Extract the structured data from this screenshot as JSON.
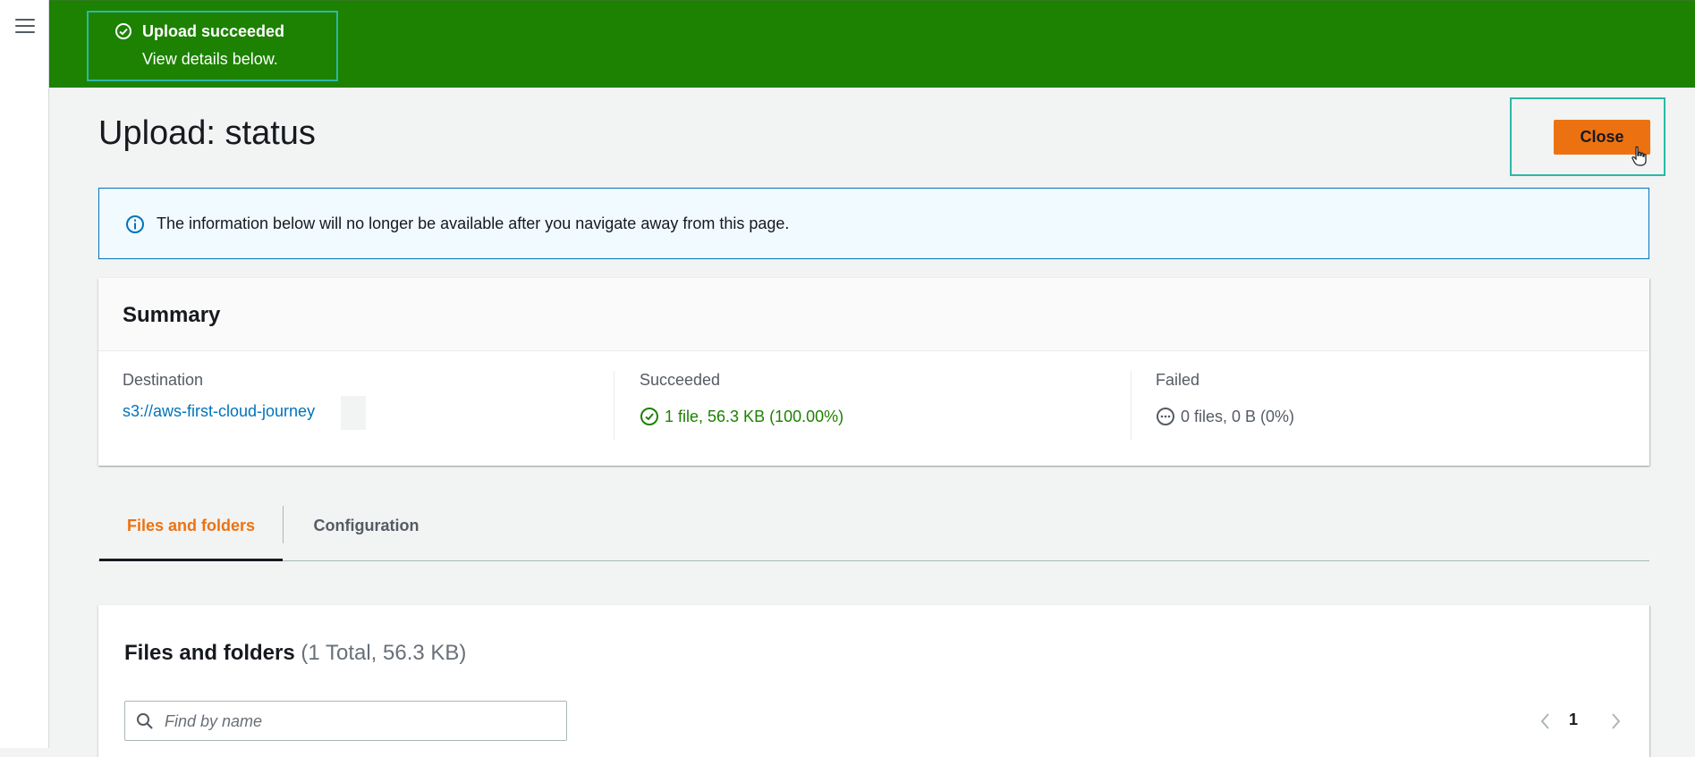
{
  "flash": {
    "title": "Upload succeeded",
    "subtitle": "View details below.",
    "icon": "check-circle-icon",
    "color": "#1d8102"
  },
  "page": {
    "title": "Upload: status",
    "close_label": "Close"
  },
  "info": {
    "icon": "info-icon",
    "text": "The information below will no longer be available after you navigate away from this page."
  },
  "summary": {
    "title": "Summary",
    "destination_label": "Destination",
    "destination_value": "s3://aws-first-cloud-journey",
    "succeeded_label": "Succeeded",
    "succeeded_value": "1 file, 56.3 KB (100.00%)",
    "failed_label": "Failed",
    "failed_value": "0 files, 0 B (0%)"
  },
  "tabs": [
    {
      "label": "Files and folders",
      "active": true
    },
    {
      "label": "Configuration",
      "active": false
    }
  ],
  "files": {
    "title": "Files and folders",
    "count": "(1 Total, 56.3 KB)",
    "search_placeholder": "Find by name",
    "page_number": "1"
  },
  "colors": {
    "accent": "#ec7211",
    "success": "#1d8102",
    "link": "#0073bb",
    "highlight": "#2bb8a5"
  }
}
